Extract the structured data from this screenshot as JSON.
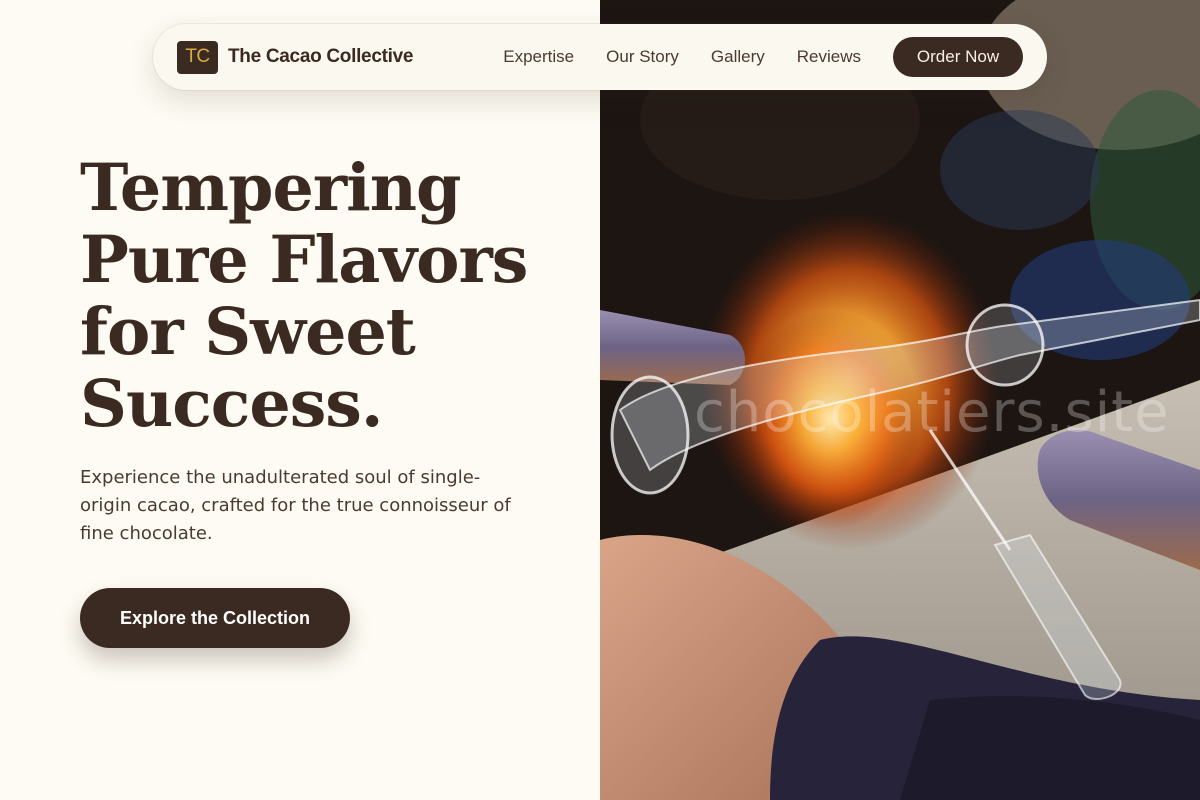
{
  "brand": {
    "logo_text": "TC",
    "name": "The Cacao Collective"
  },
  "nav": {
    "links": [
      "Expertise",
      "Our Story",
      "Gallery",
      "Reviews"
    ],
    "cta_label": "Order Now"
  },
  "hero": {
    "title": "Tempering Pure Flavors for Sweet Success.",
    "subtitle": "Experience the unadulterated soul of single-origin cacao, crafted for the true connoisseur of fine chocolate.",
    "cta_label": "Explore the Collection"
  },
  "image": {
    "watermark": "chocolatiers.site"
  },
  "colors": {
    "background": "#fdfbf3",
    "primary_dark": "#3b2a21",
    "accent_gold": "#d8ab44"
  }
}
